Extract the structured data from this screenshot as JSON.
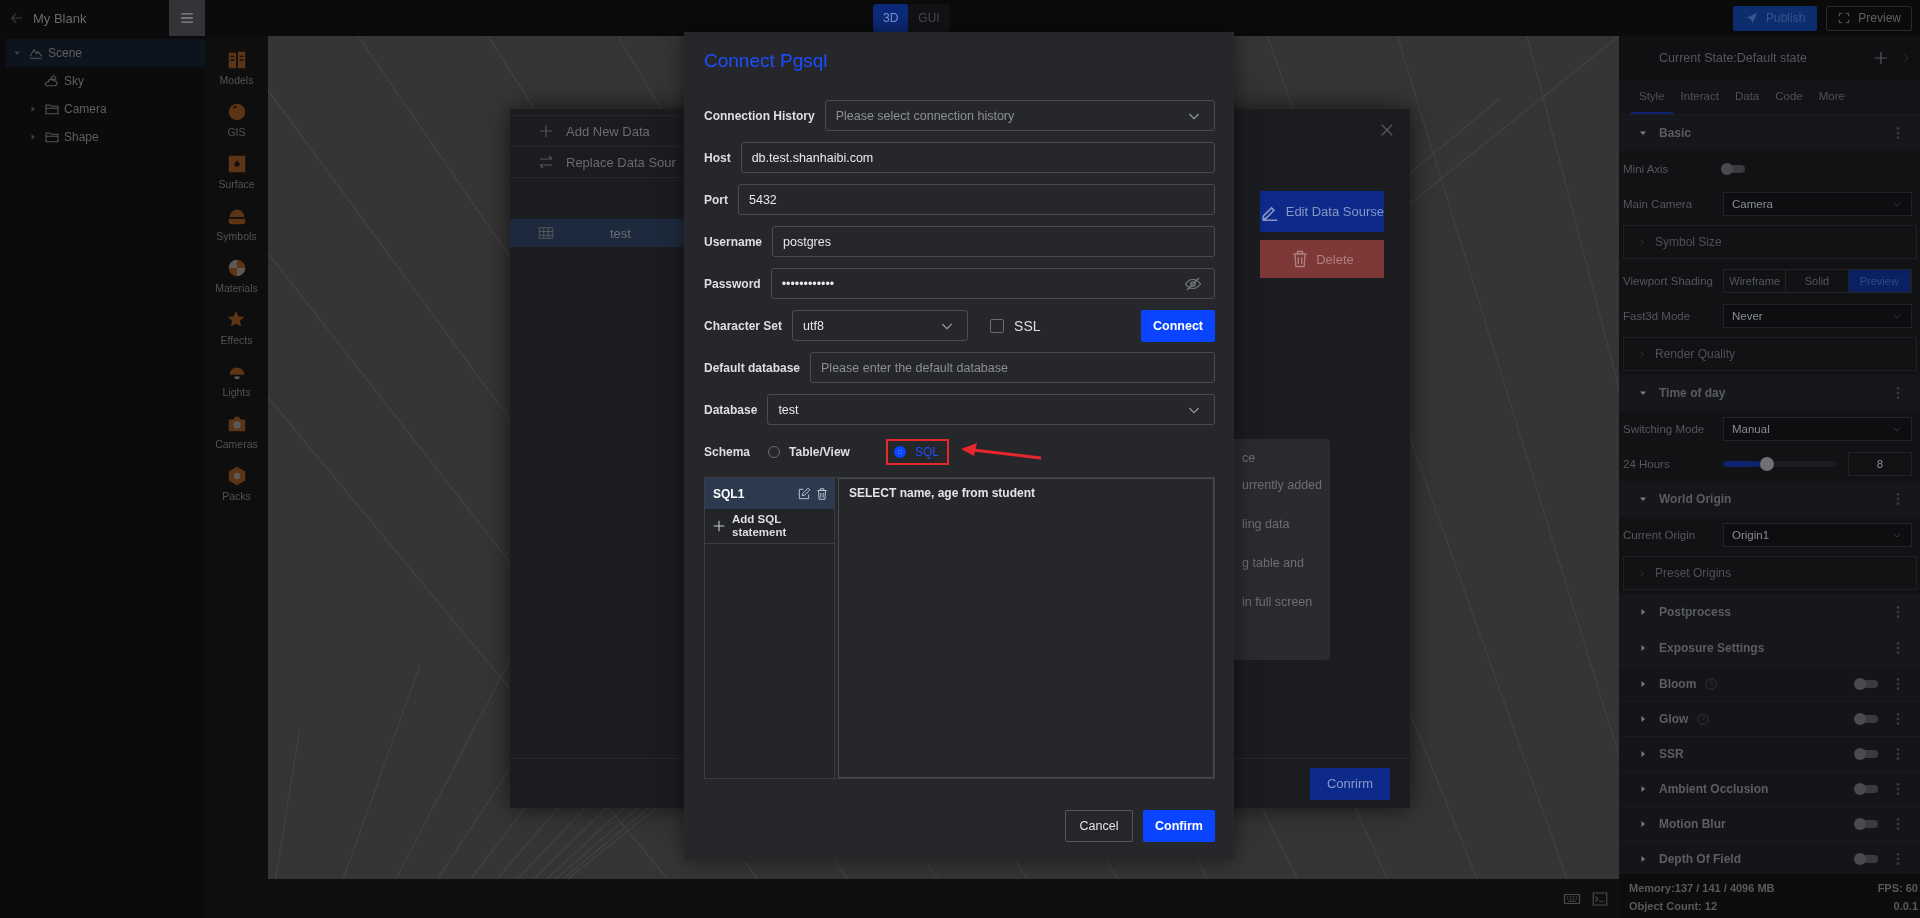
{
  "top_bar": {
    "title": "My Blank",
    "view_tabs": [
      {
        "label": "3D",
        "selected": true
      },
      {
        "label": "GUI",
        "selected": false
      }
    ],
    "publish_button": "Publish",
    "preview_button": "Preview"
  },
  "scene_tree": [
    {
      "label": "Scene",
      "kind": "scene",
      "expanded": true,
      "selected": true,
      "children": [
        {
          "label": "Sky",
          "kind": "sky",
          "selected": false
        },
        {
          "label": "Camera",
          "kind": "folder",
          "expanded": false,
          "selected": false
        },
        {
          "label": "Shape",
          "kind": "folder",
          "expanded": false,
          "selected": false
        }
      ]
    }
  ],
  "toolbox": [
    {
      "label": "Models",
      "kind": "models"
    },
    {
      "label": "GIS",
      "kind": "gis"
    },
    {
      "label": "Surface",
      "kind": "surface"
    },
    {
      "label": "Symbols",
      "kind": "symbols"
    },
    {
      "label": "Materials",
      "kind": "materials"
    },
    {
      "label": "Effects",
      "kind": "effects"
    },
    {
      "label": "Lights",
      "kind": "lights"
    },
    {
      "label": "Cameras",
      "kind": "cameras"
    },
    {
      "label": "Packs",
      "kind": "packs"
    }
  ],
  "data_dialog": {
    "actions": [
      {
        "label": "Add New Data",
        "kind": "add"
      },
      {
        "label": "Replace Data Sour",
        "kind": "replace"
      }
    ],
    "sources": [
      {
        "label": "test",
        "selected": true
      }
    ],
    "edit_button": "Edit Data Sourse",
    "delete_button": "Delete",
    "info_lines": [
      "ce",
      "urrently added",
      "ling data",
      "g table and",
      "in full screen"
    ],
    "confirm_button": "Conrirm"
  },
  "connect_dialog": {
    "title": "Connect Pgsql",
    "fields": [
      {
        "kind": "select",
        "label": "Connection History",
        "placeholder": "Please select connection history"
      },
      {
        "kind": "text",
        "label": "Host",
        "value": "db.test.shanhaibi.com"
      },
      {
        "kind": "text",
        "label": "Port",
        "value": "5432"
      },
      {
        "kind": "text",
        "label": "Username",
        "value": "postgres"
      },
      {
        "kind": "password",
        "label": "Password",
        "value": "••••••••••••"
      },
      {
        "kind": "charset",
        "label": "Character Set",
        "value": "utf8",
        "ssl_label": "SSL",
        "ssl_checked": false,
        "action": "Connect"
      },
      {
        "kind": "text",
        "label": "Default database",
        "placeholder": "Please enter the default database"
      },
      {
        "kind": "select",
        "label": "Database",
        "value": "test"
      }
    ],
    "schema": {
      "label": "Schema",
      "options": [
        {
          "label": "Table/View",
          "selected": false,
          "annotated": false
        },
        {
          "label": "SQL",
          "selected": true,
          "annotated": true
        }
      ]
    },
    "statements": [
      {
        "label": "SQL1",
        "selected": true
      }
    ],
    "add_statement": "Add SQL statement",
    "sql": "SELECT name, age from student",
    "cancel_button": "Cancel",
    "confirm_button": "Confirm"
  },
  "properties": {
    "state": "Current State:Default state",
    "tabs": [
      {
        "label": "Style",
        "selected": true
      },
      {
        "label": "Interact",
        "selected": false
      },
      {
        "label": "Data",
        "selected": false
      },
      {
        "label": "Code",
        "selected": false
      },
      {
        "label": "More",
        "selected": false
      }
    ],
    "items": [
      {
        "kind": "section",
        "label": "Basic",
        "expanded": true
      },
      {
        "kind": "toggle",
        "label": "Mini Axis",
        "on": false
      },
      {
        "kind": "select",
        "label": "Main Camera",
        "value": "Camera"
      },
      {
        "kind": "group",
        "label": "Symbol Size",
        "expanded": false
      },
      {
        "kind": "segmented",
        "label": "Viewport Shading",
        "options": [
          {
            "label": "Wireframe",
            "selected": false
          },
          {
            "label": "Solid",
            "selected": false
          },
          {
            "label": "Preview",
            "selected": true
          }
        ]
      },
      {
        "kind": "select",
        "label": "Fast3d Mode",
        "value": "Never"
      },
      {
        "kind": "group",
        "label": "Render Quality",
        "expanded": false
      },
      {
        "kind": "section",
        "label": "Time of day",
        "expanded": true
      },
      {
        "kind": "select",
        "label": "Switching Mode",
        "value": "Manual"
      },
      {
        "kind": "slider",
        "label": "24 Hours",
        "level": 0.33,
        "value": "8"
      },
      {
        "kind": "section",
        "label": "World Origin",
        "expanded": true
      },
      {
        "kind": "select",
        "label": "Current Origin",
        "value": "Origin1"
      },
      {
        "kind": "group",
        "label": "Preset Origins",
        "expanded": false
      },
      {
        "kind": "section",
        "label": "Postprocess",
        "expanded": false
      },
      {
        "kind": "section",
        "label": "Exposure Settings",
        "expanded": false
      },
      {
        "kind": "effect",
        "label": "Bloom",
        "help": true,
        "on": false,
        "disabled": true
      },
      {
        "kind": "effect",
        "label": "Glow",
        "help": true,
        "on": false,
        "disabled": true
      },
      {
        "kind": "effect",
        "label": "SSR",
        "help": false,
        "on": false,
        "disabled": true
      },
      {
        "kind": "effect",
        "label": "Ambient Occlusion",
        "help": false,
        "on": false,
        "disabled": true
      },
      {
        "kind": "effect",
        "label": "Motion Blur",
        "help": false,
        "on": false,
        "disabled": true
      },
      {
        "kind": "effect",
        "label": "Depth Of Field",
        "help": false,
        "on": false,
        "disabled": true
      }
    ]
  },
  "status": {
    "memory": "Memory:137 / 141 / 4096 MB",
    "fps": "FPS: 60",
    "object_count": "Object Count: 12",
    "version": "0.0.1"
  }
}
